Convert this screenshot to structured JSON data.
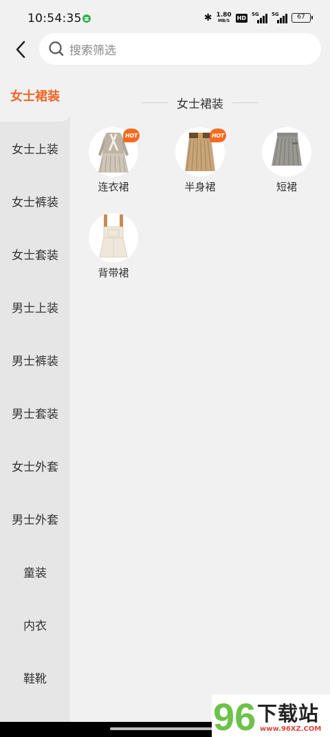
{
  "status_bar": {
    "time": "10:54:35",
    "bluetooth_icon": "bluetooth-icon",
    "net_speed_value": "1.80",
    "net_speed_unit": "MB/S",
    "hd_label": "HD",
    "signal1_label": "5G",
    "signal2_label": "5G",
    "battery": "67"
  },
  "header": {
    "back_icon": "chevron-left-icon",
    "search_placeholder": "搜索筛选"
  },
  "sidebar": {
    "items": [
      {
        "label": "女士裙装",
        "active": true
      },
      {
        "label": "女士上装",
        "active": false
      },
      {
        "label": "女士裤装",
        "active": false
      },
      {
        "label": "女士套装",
        "active": false
      },
      {
        "label": "男士上装",
        "active": false
      },
      {
        "label": "男士裤装",
        "active": false
      },
      {
        "label": "男士套装",
        "active": false
      },
      {
        "label": "女士外套",
        "active": false
      },
      {
        "label": "男士外套",
        "active": false
      },
      {
        "label": "童装",
        "active": false
      },
      {
        "label": "内衣",
        "active": false
      },
      {
        "label": "鞋靴",
        "active": false
      }
    ]
  },
  "content": {
    "section_title": "女士裙装",
    "categories": [
      {
        "label": "连衣裙",
        "badge": "HOT"
      },
      {
        "label": "半身裙",
        "badge": "HOT"
      },
      {
        "label": "短裙",
        "badge": ""
      },
      {
        "label": "背带裙",
        "badge": ""
      }
    ]
  },
  "watermark": {
    "logo_number": "96",
    "name": "下载站",
    "url": "www.96XZ.COM"
  },
  "colors": {
    "accent": "#f06424",
    "badge": "#f56a1f",
    "sidebar_bg": "#e6e6e6",
    "page_bg": "#f1f1f1"
  }
}
